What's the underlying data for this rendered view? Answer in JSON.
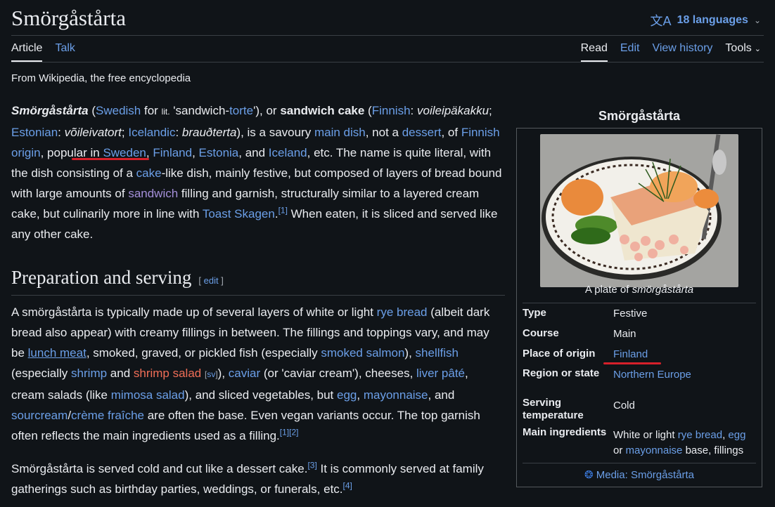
{
  "header": {
    "title": "Smörgåstårta",
    "languages_label": "18 languages"
  },
  "tabs": {
    "article": "Article",
    "talk": "Talk",
    "read": "Read",
    "edit": "Edit",
    "view_history": "View history",
    "tools": "Tools"
  },
  "tagline": "From Wikipedia, the free encyclopedia",
  "lead": {
    "term": "Smörgåstårta",
    "swedish": "Swedish",
    "for": " for ",
    "ipa": "lit.",
    "quote_open": " 'sandwich-",
    "torte": "torte",
    "quote_close": "'), or ",
    "alt_name": "sandwich cake",
    "finnish": "Finnish",
    "finnish_name": "voileipäkakku",
    "estonian": "Estonian",
    "estonian_name": "võileivatort",
    "icelandic": "Icelandic",
    "icelandic_name": "brauðterta",
    "is_a": "), is a savoury ",
    "main_dish": "main dish",
    "not_a": ", not a ",
    "dessert": "dessert",
    "of": ", of ",
    "finnish_origin": "Finnish origin",
    "popular": ", popular in ",
    "sweden": "Sweden",
    "finland": "Finland",
    "estonia": "Estonia",
    "and": ", and ",
    "iceland": "Iceland",
    "etc": ", etc. The name is quite literal, with the dish consisting of a ",
    "cake": "cake",
    "like_dish": "-like dish, mainly festive, but composed of layers of bread bound with large amounts of ",
    "sandwich": "sandwich",
    "filling": " filling and garnish, structurally similar to a layered cream cake, but culinarily more in line with ",
    "toast": "Toast Skagen",
    "ref1": "[1]",
    "end": " When eaten, it is sliced and served like any other cake."
  },
  "section": {
    "heading": "Preparation and serving",
    "edit_label": "edit"
  },
  "prep": {
    "t1": "A smörgåstårta is typically made up of several layers of white or light ",
    "rye_bread": "rye bread",
    "t2": " (albeit dark bread also appear) with creamy fillings in between. The fillings and toppings vary, and may be ",
    "lunch_meat": "lunch meat",
    "t3": ", smoked, graved, or pickled fish (especially ",
    "smoked_salmon": "smoked salmon",
    "t4": "), ",
    "shellfish": "shellfish",
    "t5": " (especially ",
    "shrimp": "shrimp",
    "t6": " and ",
    "shrimp_salad": "shrimp salad",
    "sv": "sv",
    "t7": "), ",
    "caviar": "caviar",
    "t8": " (or 'caviar cream'), cheeses, ",
    "liver_pate": "liver pâté",
    "t9": ", cream salads (like ",
    "mimosa_salad": "mimosa salad",
    "t10": "), and sliced vegetables, but ",
    "egg": "egg",
    "t11": ", ",
    "mayonnaise": "mayonnaise",
    "t12": ", and ",
    "sourcream": "sourcream",
    "slash": "/",
    "creme_fraiche": "crème fraîche",
    "t13": " are often the base. Even vegan variants occur. The top garnish often reflects the main ingredients used as a filling.",
    "ref1": "[1]",
    "ref2": "[2]"
  },
  "serve": {
    "t1": "Smörgåstårta is served cold and cut like a dessert cake.",
    "ref3": "[3]",
    "t2": " It is commonly served at family gatherings such as birthday parties, weddings, or funerals, etc.",
    "ref4": "[4]"
  },
  "infobox": {
    "caption": "Smörgåstårta",
    "image_caption_prefix": "A plate of ",
    "image_caption_term": "smörgåstårta",
    "rows": [
      {
        "label": "Type",
        "value": "Festive"
      },
      {
        "label": "Course",
        "value": "Main"
      },
      {
        "label": "Place of origin",
        "value": "Finland"
      },
      {
        "label": "Region or state",
        "value": "Northern Europe"
      },
      {
        "label": "Serving temperature",
        "value": "Cold"
      },
      {
        "label": "Main ingredients",
        "v1": "White or light ",
        "rye_bread": "rye bread",
        "comma": ", ",
        "egg": "egg",
        "or": "or ",
        "mayonnaise": "mayonnaise",
        "rest": " base, fillings"
      }
    ],
    "media": "Media: Smörgåstårta"
  },
  "colors": {
    "background": "#101418",
    "link": "#6b9fe8",
    "visited": "#a48fd9",
    "redlink": "#f06e57",
    "annotation": "#d6202a"
  }
}
